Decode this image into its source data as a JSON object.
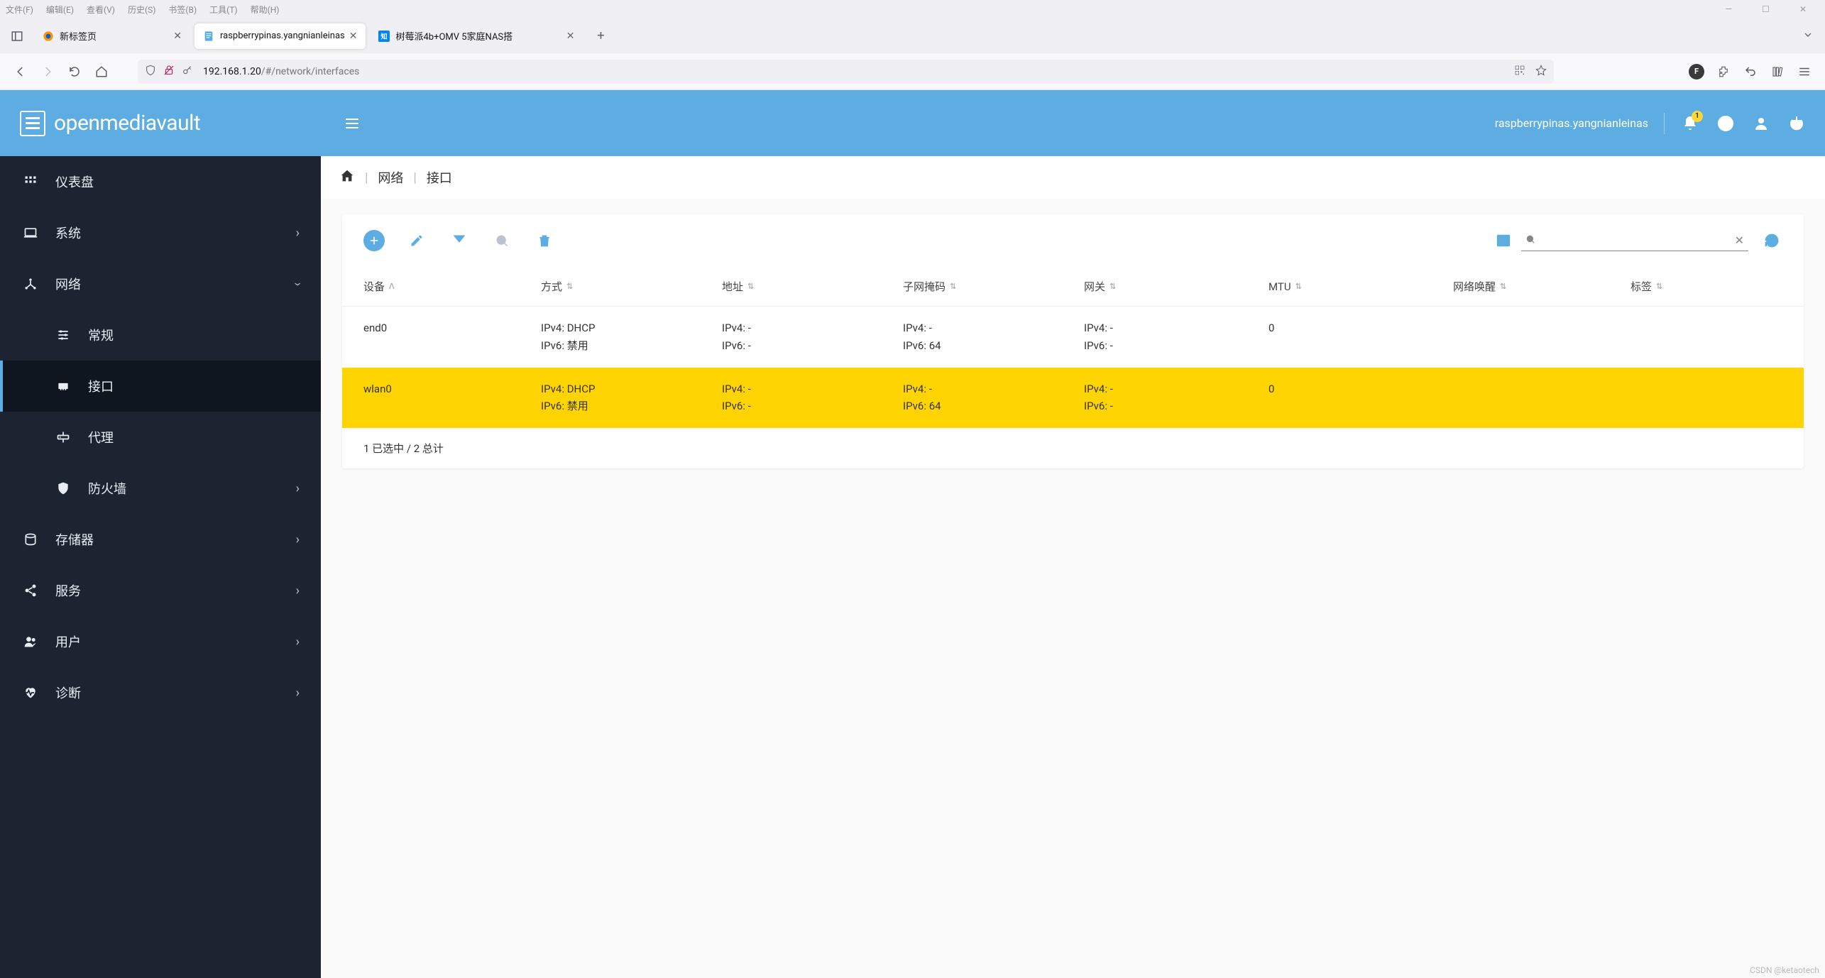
{
  "firefox": {
    "menus": [
      "文件(F)",
      "编辑(E)",
      "查看(V)",
      "历史(S)",
      "书签(B)",
      "工具(T)",
      "帮助(H)"
    ],
    "tabs": [
      {
        "label": "新标签页",
        "favicon": "firefox"
      },
      {
        "label": "raspberrypinas.yangnianleinas",
        "favicon": "doc",
        "active": true
      },
      {
        "label": "树莓派4b+OMV 5家庭NAS搭",
        "favicon": "zhi"
      }
    ],
    "url_host": "192.168.1.20",
    "url_path": "/#/network/interfaces"
  },
  "omv": {
    "brand": "openmediavault",
    "hostname": "raspberrypinas.yangnianleinas",
    "notif_count": "1",
    "breadcrumb": [
      "网络",
      "接口"
    ]
  },
  "sidebar": {
    "items": [
      {
        "label": "仪表盘",
        "icon": "dashboard"
      },
      {
        "label": "系统",
        "icon": "laptop",
        "children": true
      },
      {
        "label": "网络",
        "icon": "network",
        "children": true,
        "expanded": true,
        "sub": [
          {
            "label": "常规",
            "icon": "sliders"
          },
          {
            "label": "接口",
            "icon": "nic",
            "selected": true
          },
          {
            "label": "代理",
            "icon": "proxy"
          },
          {
            "label": "防火墙",
            "icon": "shield",
            "children": true
          }
        ]
      },
      {
        "label": "存储器",
        "icon": "storage",
        "children": true
      },
      {
        "label": "服务",
        "icon": "share",
        "children": true
      },
      {
        "label": "用户",
        "icon": "users",
        "children": true
      },
      {
        "label": "诊断",
        "icon": "heartbeat",
        "children": true
      }
    ]
  },
  "table": {
    "columns": [
      "设备",
      "方式",
      "地址",
      "子网掩码",
      "网关",
      "MTU",
      "网络唤醒",
      "标签"
    ],
    "rows": [
      {
        "device": "end0",
        "method": "IPv4: DHCP\nIPv6: 禁用",
        "addr": "IPv4: -\nIPv6: -",
        "mask": "IPv4: -\nIPv6: 64",
        "gw": "IPv4: -\nIPv6: -",
        "mtu": "0",
        "wol": "",
        "tag": ""
      },
      {
        "device": "wlan0",
        "method": "IPv4: DHCP\nIPv6: 禁用",
        "addr": "IPv4: -\nIPv6: -",
        "mask": "IPv4: -\nIPv6: 64",
        "gw": "IPv4: -\nIPv6: -",
        "mtu": "0",
        "wol": "",
        "tag": "",
        "selected": true
      }
    ],
    "footer": "1 已选中 / 2 总计"
  },
  "watermark": "CSDN @ketaotech"
}
